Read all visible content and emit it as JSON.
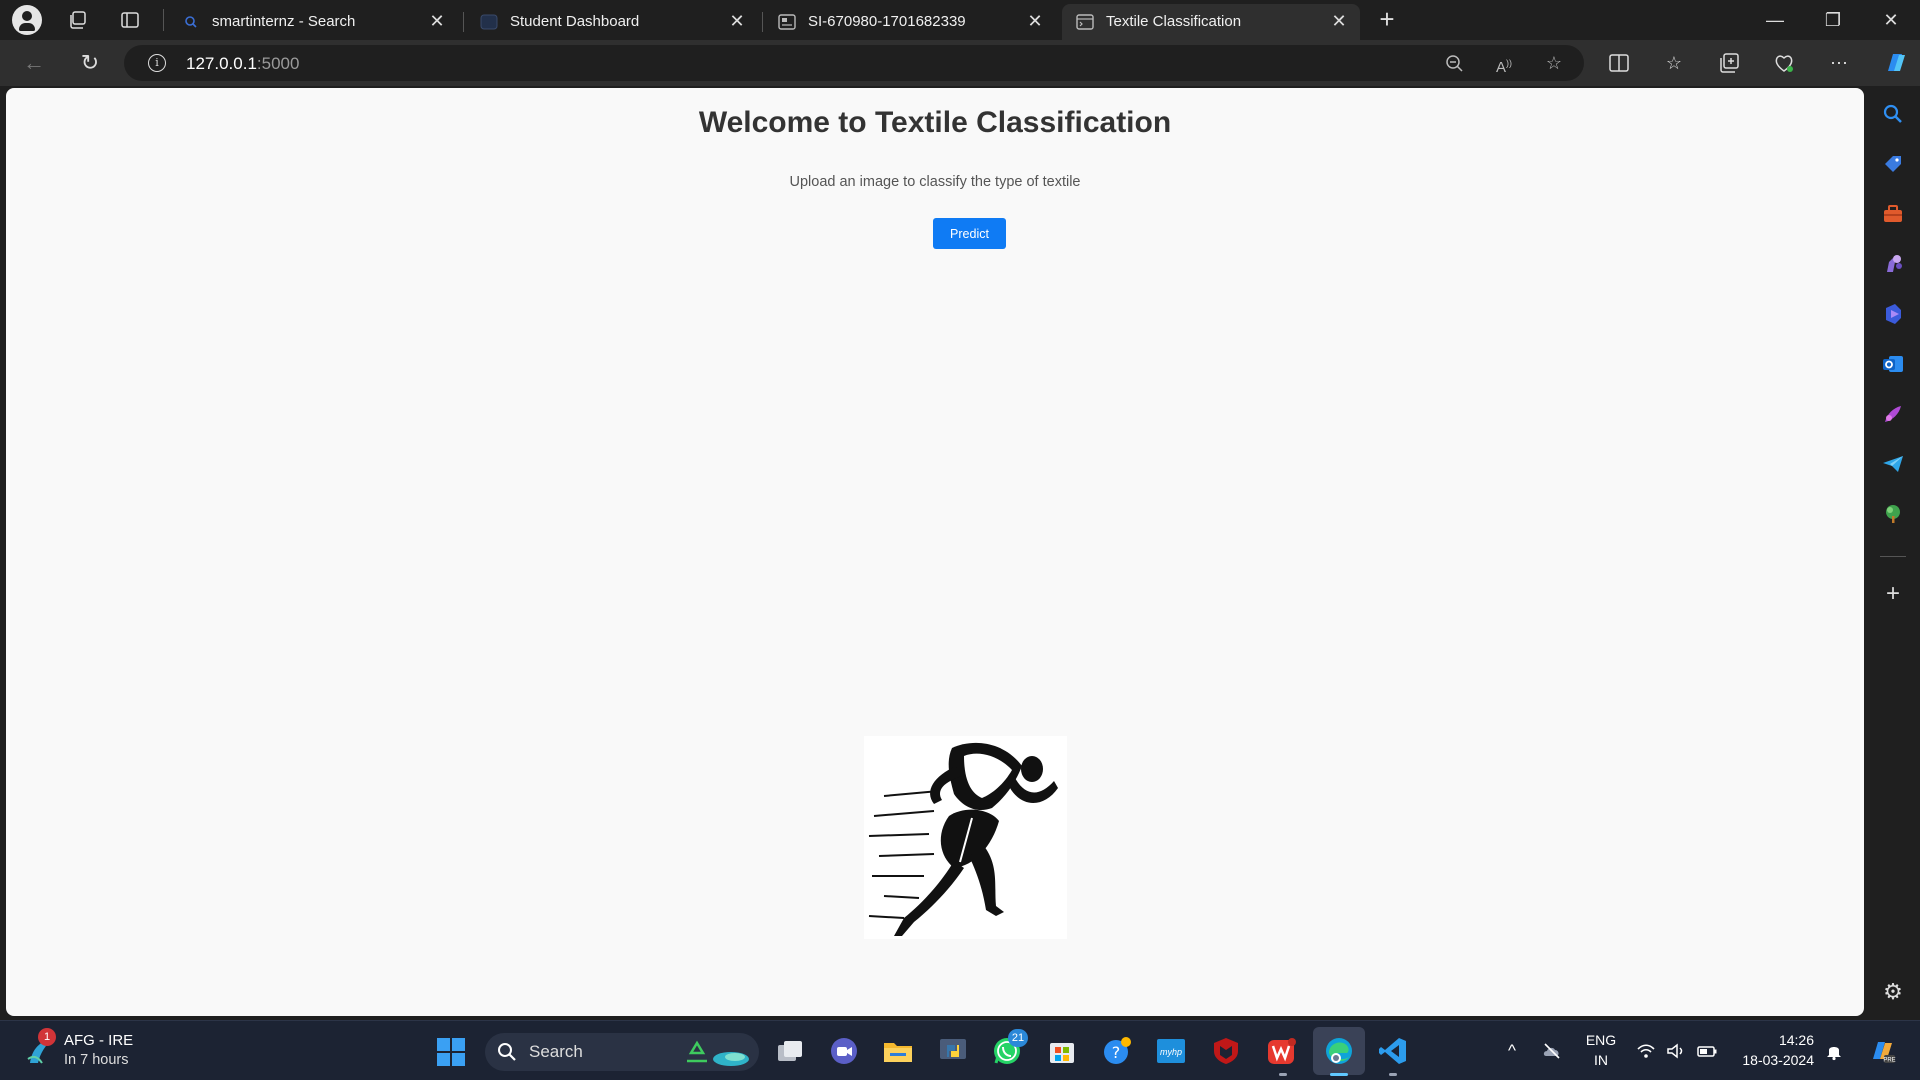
{
  "browser": {
    "tabs": [
      {
        "title": "smartinternz - Search",
        "icon": "search-icon",
        "active": false
      },
      {
        "title": "Student Dashboard",
        "icon": "page-icon",
        "active": false
      },
      {
        "title": "SI-670980-1701682339",
        "icon": "document-icon",
        "active": false
      },
      {
        "title": "Textile Classification",
        "icon": "page-icon",
        "active": true
      }
    ],
    "address": {
      "host": "127.0.0.1",
      "port": ":5000"
    }
  },
  "page": {
    "title": "Welcome to Textile Classification",
    "subtitle": "Upload an image to classify the type of textile",
    "predict_label": "Predict",
    "preview_image": "running-man-sketch"
  },
  "taskbar": {
    "weather": {
      "line1": "AFG - IRE",
      "line2": "In 7 hours",
      "badge": "1"
    },
    "search_label": "Search",
    "whatsapp_badge": "21",
    "tray": {
      "lang1": "ENG",
      "lang2": "IN",
      "time": "14:26",
      "date": "18-03-2024"
    }
  },
  "colors": {
    "accent": "#0f7bf4",
    "page_bg": "#f9f9f9",
    "chrome_bg": "#1f1f1f",
    "taskbar_bg": "#1c2333"
  }
}
